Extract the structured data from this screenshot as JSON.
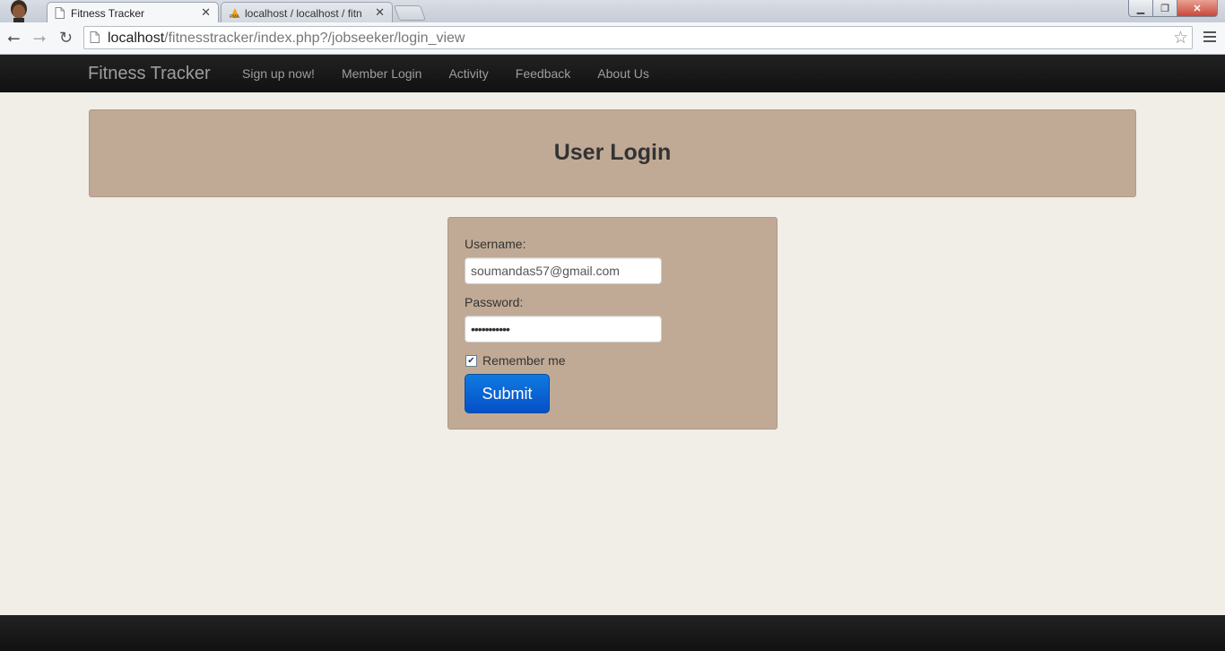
{
  "browser": {
    "tabs": [
      {
        "title": "Fitness Tracker",
        "active": true
      },
      {
        "title": "localhost / localhost / fitn",
        "active": false
      }
    ],
    "url_host": "localhost",
    "url_path": "/fitnesstracker/index.php?/jobseeker/login_view"
  },
  "navbar": {
    "brand": "Fitness Tracker",
    "links": [
      "Sign up now!",
      "Member Login",
      "Activity",
      "Feedback",
      "About Us"
    ]
  },
  "hero": {
    "title": "User Login"
  },
  "form": {
    "username_label": "Username:",
    "username_value": "soumandas57@gmail.com",
    "password_label": "Password:",
    "password_mask": "•••••••••••",
    "remember_label": "Remember me",
    "remember_checked": true,
    "submit_label": "Submit"
  },
  "colors": {
    "panel": "#c0aa95",
    "navbar": "#1b1b1b",
    "button": "#0a64d6"
  }
}
